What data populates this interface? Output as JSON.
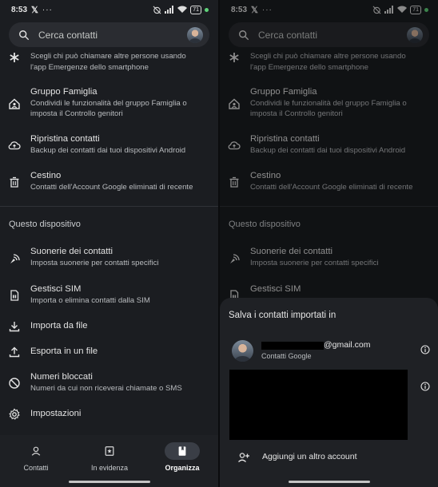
{
  "status": {
    "time": "8:53",
    "x": "𝕏",
    "dots": "···",
    "battery": "71"
  },
  "search": {
    "placeholder": "Cerca contatti"
  },
  "menu": {
    "emergency_desc1": "Scegli chi può chiamare altre persone usando",
    "emergency_desc2": "l'app Emergenze dello smartphone",
    "family_title": "Gruppo Famiglia",
    "family_desc1": "Condividi le funzionalità del gruppo Famiglia o",
    "family_desc2": "imposta il Controllo genitori",
    "restore_title": "Ripristina contatti",
    "restore_desc": "Backup dei contatti dai tuoi dispositivi Android",
    "trash_title": "Cestino",
    "trash_desc": "Contatti dell'Account Google eliminati di recente",
    "section_device": "Questo dispositivo",
    "ringtones_title": "Suonerie dei contatti",
    "ringtones_desc": "Imposta suonerie per contatti specifici",
    "sim_title": "Gestisci SIM",
    "sim_desc": "Importa o elimina contatti dalla SIM",
    "import_title": "Importa da file",
    "export_title": "Esporta in un file",
    "blocked_title": "Numeri bloccati",
    "blocked_desc": "Numeri da cui non riceverai chiamate o SMS",
    "settings_title": "Impostazioni"
  },
  "nav": {
    "contacts": "Contatti",
    "highlights": "In evidenza",
    "organize": "Organizza"
  },
  "sheet": {
    "title": "Salva i contatti importati in",
    "email_suffix": "@gmail.com",
    "account_type": "Contatti Google",
    "add_account": "Aggiungi un altro account"
  },
  "colors": {
    "background": "#1b1d21",
    "active_pill": "#3a3e46",
    "signal_dot": "#5fd37a"
  }
}
